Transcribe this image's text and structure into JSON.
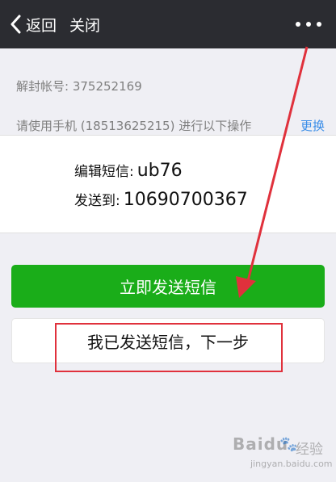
{
  "topbar": {
    "back_label": "返回",
    "close_label": "关闭",
    "more_icon": "more-dots-icon"
  },
  "account": {
    "label": "解封帐号:",
    "number": "375252169"
  },
  "phone_instruction": {
    "text": "请使用手机 (18513625215) 进行以下操作",
    "change_link": "更换"
  },
  "sms": {
    "edit_label": "编辑短信:",
    "edit_value": "ub76",
    "send_to_label": "发送到:",
    "send_to_value": "10690700367"
  },
  "buttons": {
    "send_now": "立即发送短信",
    "sent_next": "我已发送短信，下一步"
  },
  "watermark": {
    "logo": "Baidu",
    "text": "经验",
    "url": "jingyan.baidu.com"
  },
  "colors": {
    "topbar": "#2b2c31",
    "background": "#efeff4",
    "primary_button": "#1aad19",
    "link": "#3b8ee8",
    "annotation": "#e0313c"
  }
}
